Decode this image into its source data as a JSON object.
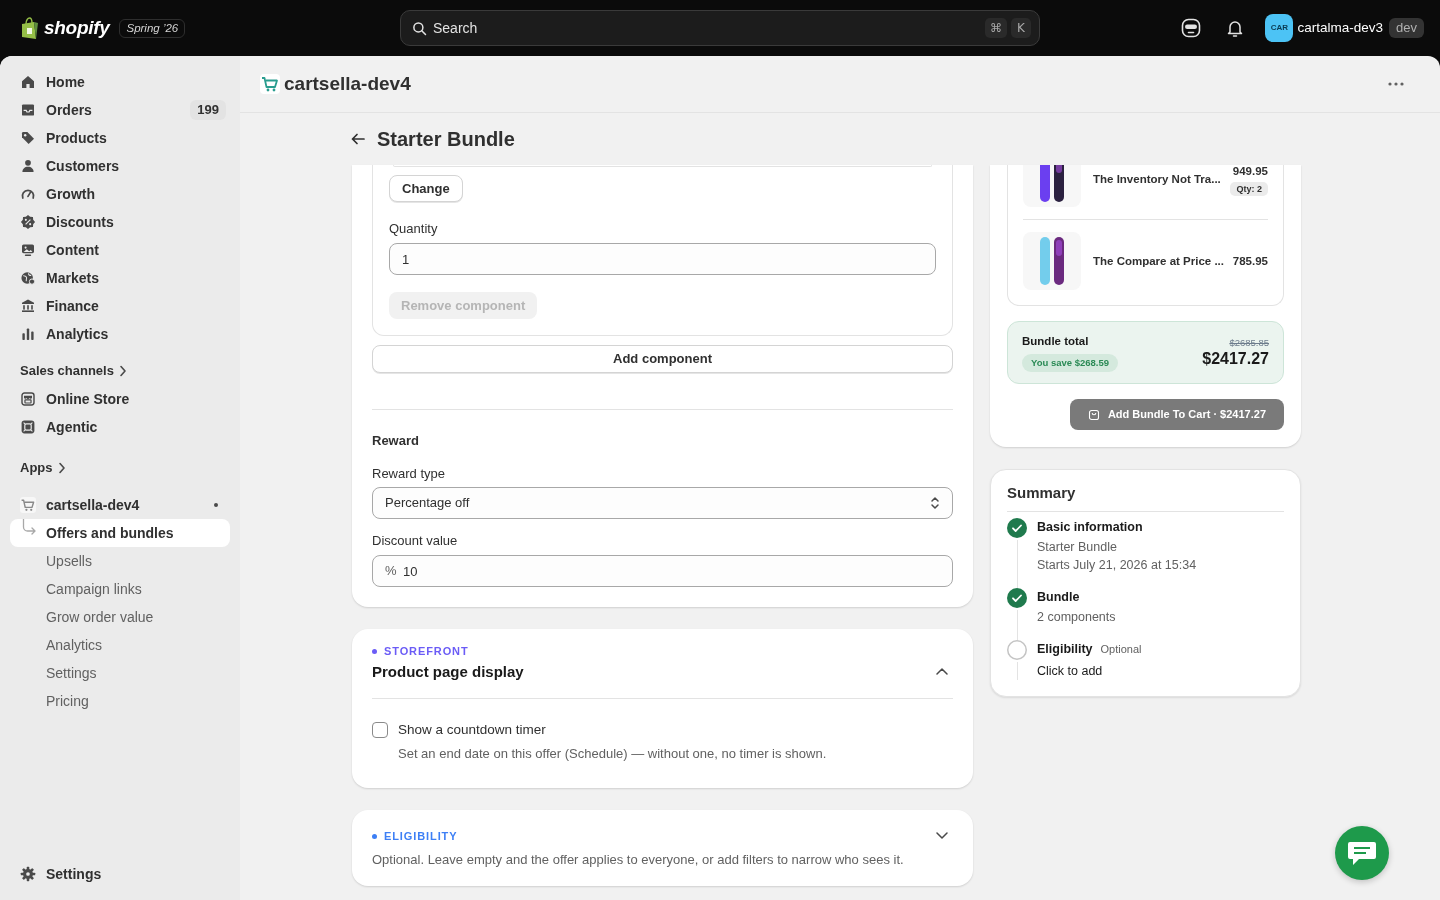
{
  "topbar": {
    "brand": "shopify",
    "edition": "Spring ’26",
    "search": {
      "placeholder": "Search",
      "keys": [
        "⌘",
        "K"
      ]
    },
    "account": {
      "initials": "CAR",
      "name": "cartalma-dev3",
      "badge": "dev"
    }
  },
  "sidebar": {
    "items": [
      {
        "label": "Home",
        "selected": false
      },
      {
        "label": "Orders",
        "count": "199",
        "selected": false
      },
      {
        "label": "Products",
        "selected": false
      },
      {
        "label": "Customers",
        "selected": false
      },
      {
        "label": "Growth",
        "selected": false
      },
      {
        "label": "Discounts",
        "selected": false
      },
      {
        "label": "Content",
        "selected": false
      },
      {
        "label": "Markets",
        "selected": false
      },
      {
        "label": "Finance",
        "selected": false
      },
      {
        "label": "Analytics",
        "selected": false
      }
    ],
    "sales_channels": {
      "heading": "Sales channels",
      "items": [
        {
          "label": "Online Store",
          "selected": false
        },
        {
          "label": "Agentic",
          "selected": false
        }
      ]
    },
    "apps": {
      "heading": "Apps",
      "items": [
        {
          "label": "cartsella-dev4",
          "selected": false,
          "children": [
            {
              "label": "Offers and bundles",
              "selected": true
            },
            {
              "label": "Upsells",
              "selected": false
            },
            {
              "label": "Campaign links",
              "selected": false
            },
            {
              "label": "Grow order value",
              "selected": false
            },
            {
              "label": "Analytics",
              "selected": false
            },
            {
              "label": "Settings",
              "selected": false
            },
            {
              "label": "Pricing",
              "selected": false
            }
          ]
        }
      ]
    },
    "footer": {
      "label": "Settings",
      "selected": false
    }
  },
  "app_bar": {
    "title": "cartsella-dev4"
  },
  "page": {
    "title": "Starter Bundle"
  },
  "bundle_editor": {
    "component": {
      "change_button": "Change",
      "quantity": {
        "label": "Quantity",
        "value": "1"
      },
      "remove_button": {
        "label": "Remove component",
        "disabled": true
      }
    },
    "add_button": "Add component",
    "reward": {
      "heading": "Reward",
      "reward_type": {
        "label": "Reward type",
        "value": "Percentage off"
      },
      "discount_value": {
        "label": "Discount value",
        "prefix": "%",
        "value": "10"
      }
    }
  },
  "sections": [
    {
      "eyebrow": "STOREFRONT",
      "color": "#6b5cf6",
      "title": "Product page display",
      "expanded": true,
      "options": [
        {
          "label": "Show a countdown timer",
          "checked": false,
          "help": "Set an end date on this offer (Schedule) — without one, no timer is shown."
        }
      ]
    },
    {
      "eyebrow": "ELIGIBILITY",
      "color": "#3d7ff5",
      "expanded": false,
      "description": "Optional. Leave empty and the offer applies to everyone, or add filters to narrow who sees it."
    }
  ],
  "preview": {
    "items": [
      {
        "name": "The Inventory Not Tra...",
        "price": "949.95",
        "quantity": "Qty: 2"
      },
      {
        "name": "The Compare at Price ...",
        "price": "785.95"
      }
    ],
    "total": {
      "label": "Bundle total",
      "savings": "You save $268.59",
      "compare_price": "$2685.85",
      "price": "$2417.27"
    },
    "cart_button": "Add Bundle To Cart · $2417.27"
  },
  "summary": {
    "title": "Summary",
    "steps": [
      {
        "title": "Basic information",
        "done": true,
        "details": [
          "Starter Bundle",
          "Starts July 21, 2026 at 15:34"
        ]
      },
      {
        "title": "Bundle",
        "done": true,
        "details": [
          "2 components"
        ]
      },
      {
        "title": "Eligibility",
        "tag": "Optional",
        "done": false,
        "action": "Click to add"
      }
    ]
  }
}
